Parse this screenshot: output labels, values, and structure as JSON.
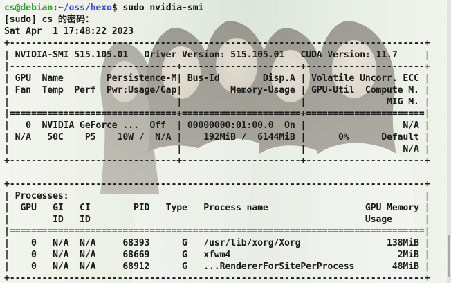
{
  "prompt": {
    "user": "cs@debian",
    "sep": ":",
    "path": "~/oss/hexo",
    "symbol": "$",
    "command": " sudo nvidia-smi"
  },
  "sudo_prompt": "[sudo] cs 的密码：",
  "timestamp": "Sat Apr  1 17:48:22 2023",
  "smi_header": {
    "top_border": "+-----------------------------------------------------------------------------+",
    "version_line": "| NVIDIA-SMI 515.105.01   Driver Version: 515.105.01   CUDA Version: 11.7     |",
    "divider": "|-------------------------------+----------------------+----------------------+",
    "col_head_1": "| GPU  Name        Persistence-M| Bus-Id        Disp.A | Volatile Uncorr. ECC |",
    "col_head_2": "| Fan  Temp  Perf  Pwr:Usage/Cap|         Memory-Usage | GPU-Util  Compute M. |",
    "col_head_3": "|                               |                      |               MIG M. |",
    "double_rule": "|===============================+======================+======================|"
  },
  "gpu_rows": [
    "|   0  NVIDIA GeForce ...  Off  | 00000000:01:00.0  On |                  N/A |",
    "| N/A   50C    P5    10W /  N/A |    192MiB /  6144MiB |      0%      Default |",
    "|                               |                      |                  N/A |"
  ],
  "gpu_bottom": "+-------------------------------+----------------------+----------------------+",
  "blank": " ",
  "processes": {
    "top_border": "+-----------------------------------------------------------------------------+",
    "title": "| Processes:                                                                  |",
    "head_1": "|  GPU   GI   CI        PID   Type   Process name                  GPU Memory |",
    "head_2": "|        ID   ID                                                   Usage      |",
    "double_rule": "|=============================================================================|",
    "rows": [
      "|    0   N/A  N/A     68393      G   /usr/lib/xorg/Xorg                138MiB |",
      "|    0   N/A  N/A     68669      G   xfwm4                               2MiB |",
      "|    0   N/A  N/A     68912      G   ...RendererForSitePerProcess       48MiB |"
    ],
    "bottom_border": "+-----------------------------------------------------------------------------+"
  }
}
